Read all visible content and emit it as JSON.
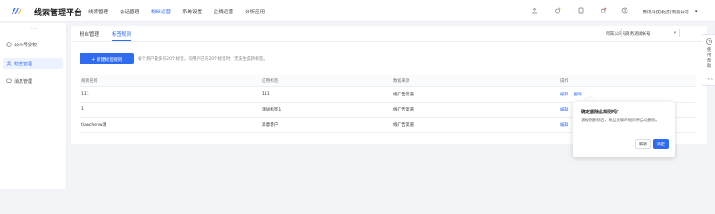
{
  "header": {
    "brand": "线索管理平台",
    "nav": [
      "线索管理",
      "会话管理",
      "粉丝运营",
      "系统设置",
      "企微运营",
      "分析应用"
    ],
    "active_nav": 2,
    "company": "腾讯科技(北京)有限公司",
    "accent": "#2f6bf0"
  },
  "sidebar": {
    "collapse_glyph": "···",
    "items": [
      {
        "label": "公众号授权",
        "icon": "circle-icon"
      },
      {
        "label": "粉丝管理",
        "icon": "user-icon"
      },
      {
        "label": "消息管理",
        "icon": "message-icon"
      }
    ],
    "active": 1
  },
  "main": {
    "tabs": [
      "粉丝管理",
      "标签规则"
    ],
    "active_tab": 1,
    "company_label": "所属公众号",
    "company_value": "商务测试帐号",
    "new_button": "+ 新建标签规则",
    "hint": "每个用户最多有20个标签，均用户已有20个标签时，无法生成新标签。",
    "table": {
      "columns": [
        "规则名称",
        "应用标签",
        "数据来源",
        "操作"
      ],
      "rows": [
        {
          "name": "111",
          "tag": "111",
          "source": "线广告渠道",
          "actions": [
            "编辑",
            "删除"
          ]
        },
        {
          "name": "1",
          "tag": "测试标签1",
          "source": "线广告渠道",
          "actions": [
            "编辑"
          ]
        },
        {
          "name": "tianchenw测",
          "tag": "高意客户",
          "source": "线广告渠道",
          "actions": [
            "编辑"
          ]
        }
      ]
    }
  },
  "popover": {
    "title": "确定删除此规则吗？",
    "body": "该规则删除后，粉丝关联的规则将自动删除。",
    "cancel": "取消",
    "confirm": "确定"
  },
  "float_panel": {
    "text": "使用帮助",
    "collapse": "<<"
  }
}
